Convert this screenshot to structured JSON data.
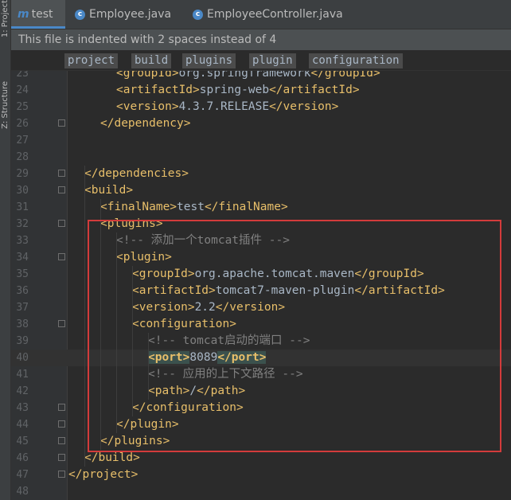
{
  "side_panel": {
    "project_label": "1: Project",
    "structure_label": "Z: Structure"
  },
  "tabs": [
    {
      "icon": "maven-module-icon",
      "glyph": "m",
      "label": "test",
      "active": true
    },
    {
      "icon": "java-class-icon",
      "glyph": "c",
      "label": "Employee.java",
      "active": false
    },
    {
      "icon": "java-class-icon",
      "glyph": "c",
      "label": "EmployeeController.java",
      "active": false
    }
  ],
  "notification": "This file is indented with 2 spaces instead of 4",
  "breadcrumbs": [
    "project",
    "build",
    "plugins",
    "plugin",
    "configuration"
  ],
  "editor": {
    "current_line": 40,
    "lines": [
      {
        "n": "23",
        "text": "<groupId>org.springframework</groupId>"
      },
      {
        "n": "24",
        "text": "<artifactId>spring-web</artifactId>"
      },
      {
        "n": "25",
        "text": "<version>4.3.7.RELEASE</version>"
      },
      {
        "n": "26",
        "text": "</dependency>"
      },
      {
        "n": "27",
        "text": ""
      },
      {
        "n": "28",
        "text": ""
      },
      {
        "n": "29",
        "text": "</dependencies>"
      },
      {
        "n": "30",
        "text": "<build>"
      },
      {
        "n": "31",
        "text": "<finalName>test</finalName>"
      },
      {
        "n": "32",
        "text": "<plugins>"
      },
      {
        "n": "33",
        "text": "<!-- 添加一个tomcat插件 -->"
      },
      {
        "n": "34",
        "text": "<plugin>"
      },
      {
        "n": "35",
        "text": "<groupId>org.apache.tomcat.maven</groupId>"
      },
      {
        "n": "36",
        "text": "<artifactId>tomcat7-maven-plugin</artifactId>"
      },
      {
        "n": "37",
        "text": "<version>2.2</version>"
      },
      {
        "n": "38",
        "text": "<configuration>"
      },
      {
        "n": "39",
        "text": "<!-- tomcat启动的端口 -->"
      },
      {
        "n": "40",
        "text": "<port>8089</port>"
      },
      {
        "n": "41",
        "text": "<!-- 应用的上下文路径 -->"
      },
      {
        "n": "42",
        "text": "<path>/</path>"
      },
      {
        "n": "43",
        "text": "</configuration>"
      },
      {
        "n": "44",
        "text": "</plugin>"
      },
      {
        "n": "45",
        "text": "</plugins>"
      },
      {
        "n": "46",
        "text": "</build>"
      },
      {
        "n": "47",
        "text": "</project>"
      },
      {
        "n": "48",
        "text": ""
      }
    ]
  },
  "colors": {
    "background": "#2B2B2B",
    "tag": "#E8BF6A",
    "text": "#A9B7C6",
    "comment": "#808080",
    "highlight_box": "#D33B3B",
    "active_tab_underline": "#4A88C7"
  }
}
